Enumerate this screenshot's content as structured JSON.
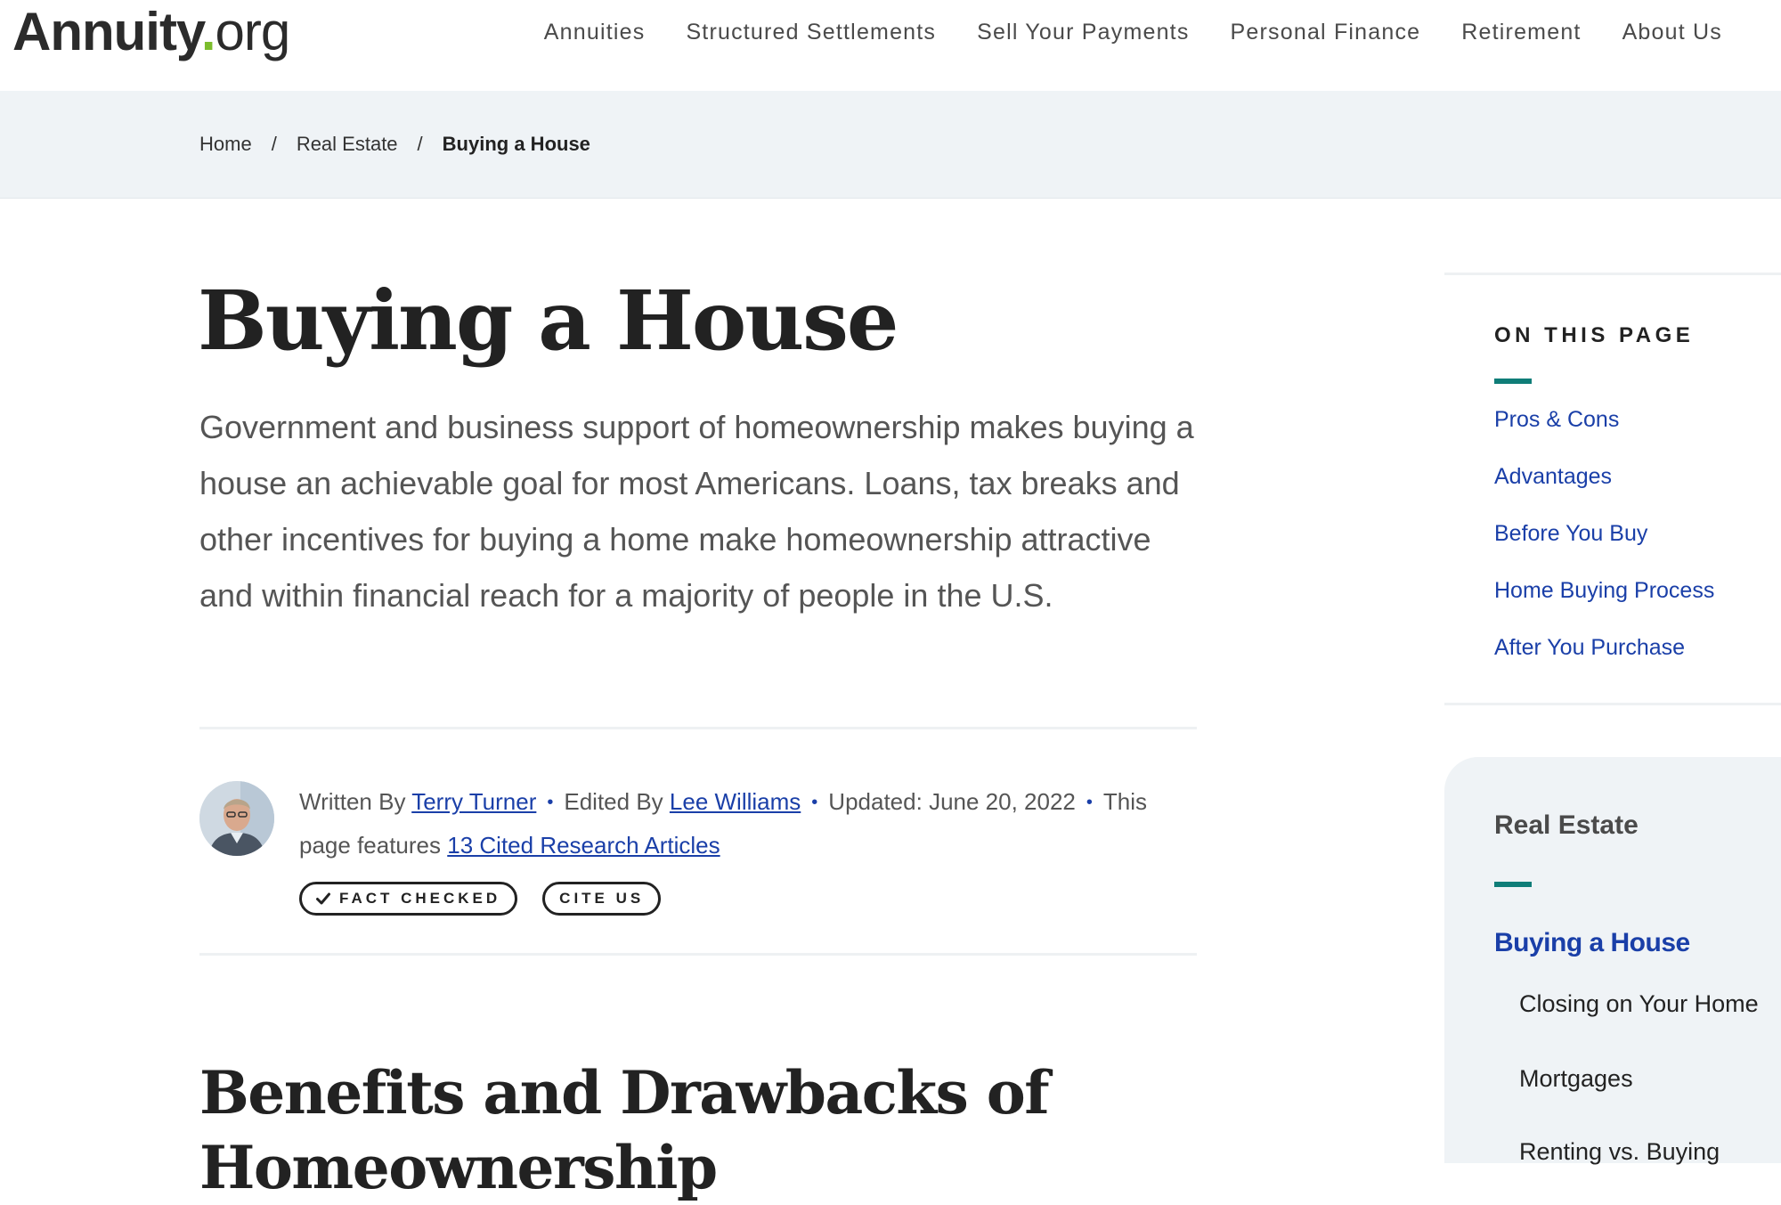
{
  "header": {
    "logo_brand": "Annuity",
    "logo_dot": ".",
    "logo_tld": "org",
    "nav": [
      "Annuities",
      "Structured Settlements",
      "Sell Your Payments",
      "Personal Finance",
      "Retirement",
      "About Us"
    ]
  },
  "breadcrumb": {
    "items": [
      "Home",
      "Real Estate"
    ],
    "separator": "/",
    "current": "Buying a House"
  },
  "article": {
    "title": "Buying a House",
    "intro": "Government and business support of homeownership makes buying a house an achievable goal for most Americans. Loans, tax breaks and other incentives for buying a home make homeownership attractive and within financial reach for a majority of people in the U.S.",
    "byline": {
      "written_by_label": "Written By",
      "author": "Terry Turner",
      "edited_by_label": "Edited By",
      "editor": "Lee Williams",
      "updated_label": "Updated:",
      "updated_date": "June 20, 2022",
      "features_prefix": "This page features",
      "citations_link": "13 Cited Research Articles",
      "separator": "•"
    },
    "badges": {
      "fact_checked": "FACT CHECKED",
      "cite_us": "CITE US"
    },
    "section_heading": "Benefits and Drawbacks of Homeownership"
  },
  "sidebar": {
    "toc_title": "ON THIS PAGE",
    "toc_links": [
      "Pros & Cons",
      "Advantages",
      "Before You Buy",
      "Home Buying Process",
      "After You Purchase"
    ],
    "related_title": "Real Estate",
    "related_active": "Buying a House",
    "related_links": [
      "Closing on Your Home",
      "Mortgages",
      "Renting vs. Buying"
    ]
  },
  "colors": {
    "link": "#1a3fa8",
    "accent": "#0f7d78",
    "logo_dot": "#7cbd2d",
    "panel_background": "#eff3f6"
  }
}
